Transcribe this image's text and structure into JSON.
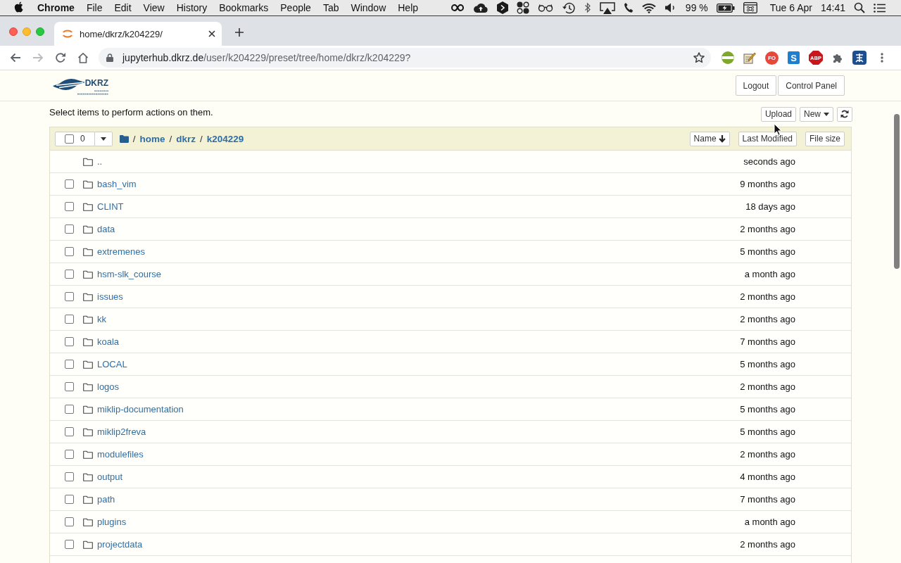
{
  "menu_bar": {
    "app_name": "Chrome",
    "menus": [
      "File",
      "Edit",
      "View",
      "History",
      "Bookmarks",
      "People",
      "Tab",
      "Window",
      "Help"
    ],
    "battery": "99 %",
    "date": "Tue 6 Apr",
    "time": "14:41"
  },
  "browser": {
    "tabs": [
      {
        "title": "home/dkrz/k204229/",
        "selected": true
      }
    ],
    "nav_buttons": [
      {
        "kind": "back",
        "disabled": false
      },
      {
        "kind": "forward",
        "disabled": true
      },
      {
        "kind": "reload",
        "disabled": false
      },
      {
        "kind": "home",
        "disabled": false
      }
    ],
    "address_bar": {
      "host": "jupyterhub.dkrz.de",
      "path": "/user/k204229/preset/tree/home/dkrz/k204229?"
    },
    "extensions": [
      {
        "kind": "disc"
      },
      {
        "kind": "notepad"
      },
      {
        "kind": "round",
        "label": "FO"
      },
      {
        "kind": "tile",
        "label": "S"
      },
      {
        "kind": "octagon",
        "label": "ABP"
      },
      {
        "kind": "puzzle"
      },
      {
        "kind": "glyph"
      }
    ]
  },
  "header": {
    "logo": {
      "name": "DKRZ"
    },
    "buttons": [
      "Logout",
      "Control Panel"
    ]
  },
  "toolbar": {
    "hint": "Select items to perform actions on them.",
    "buttons": [
      {
        "kind": "upload",
        "label": "Upload"
      },
      {
        "kind": "new",
        "label": "New"
      },
      {
        "kind": "refresh"
      }
    ]
  },
  "file_list": {
    "selection": {
      "count": "0",
      "checked": false
    },
    "breadcrumb": {
      "separator": "/",
      "items": [
        "home",
        "dkrz",
        "k204229"
      ]
    },
    "sort_buttons": [
      {
        "label": "Name",
        "sorted": true
      },
      {
        "label": "Last Modified",
        "sorted": false
      },
      {
        "label": "File size",
        "sorted": false
      }
    ],
    "rows": [
      {
        "kind": "parent",
        "name": "..",
        "modified": "seconds ago"
      },
      {
        "kind": "folder",
        "name": "bash_vim",
        "modified": "9 months ago",
        "checked": false
      },
      {
        "kind": "folder",
        "name": "CLINT",
        "modified": "18 days ago",
        "checked": false
      },
      {
        "kind": "folder",
        "name": "data",
        "modified": "2 months ago",
        "checked": false
      },
      {
        "kind": "folder",
        "name": "extremenes",
        "modified": "5 months ago",
        "checked": false
      },
      {
        "kind": "folder",
        "name": "hsm-slk_course",
        "modified": "a month ago",
        "checked": false
      },
      {
        "kind": "folder",
        "name": "issues",
        "modified": "2 months ago",
        "checked": false
      },
      {
        "kind": "folder",
        "name": "kk",
        "modified": "2 months ago",
        "checked": false
      },
      {
        "kind": "folder",
        "name": "koala",
        "modified": "7 months ago",
        "checked": false
      },
      {
        "kind": "folder",
        "name": "LOCAL",
        "modified": "5 months ago",
        "checked": false
      },
      {
        "kind": "folder",
        "name": "logos",
        "modified": "2 months ago",
        "checked": false
      },
      {
        "kind": "folder",
        "name": "miklip-documentation",
        "modified": "5 months ago",
        "checked": false
      },
      {
        "kind": "folder",
        "name": "miklip2freva",
        "modified": "5 months ago",
        "checked": false
      },
      {
        "kind": "folder",
        "name": "modulefiles",
        "modified": "2 months ago",
        "checked": false
      },
      {
        "kind": "folder",
        "name": "output",
        "modified": "4 months ago",
        "checked": false
      },
      {
        "kind": "folder",
        "name": "path",
        "modified": "7 months ago",
        "checked": false
      },
      {
        "kind": "folder",
        "name": "plugins",
        "modified": "a month ago",
        "checked": false
      },
      {
        "kind": "folder",
        "name": "projectdata",
        "modified": "2 months ago",
        "checked": false
      }
    ]
  }
}
